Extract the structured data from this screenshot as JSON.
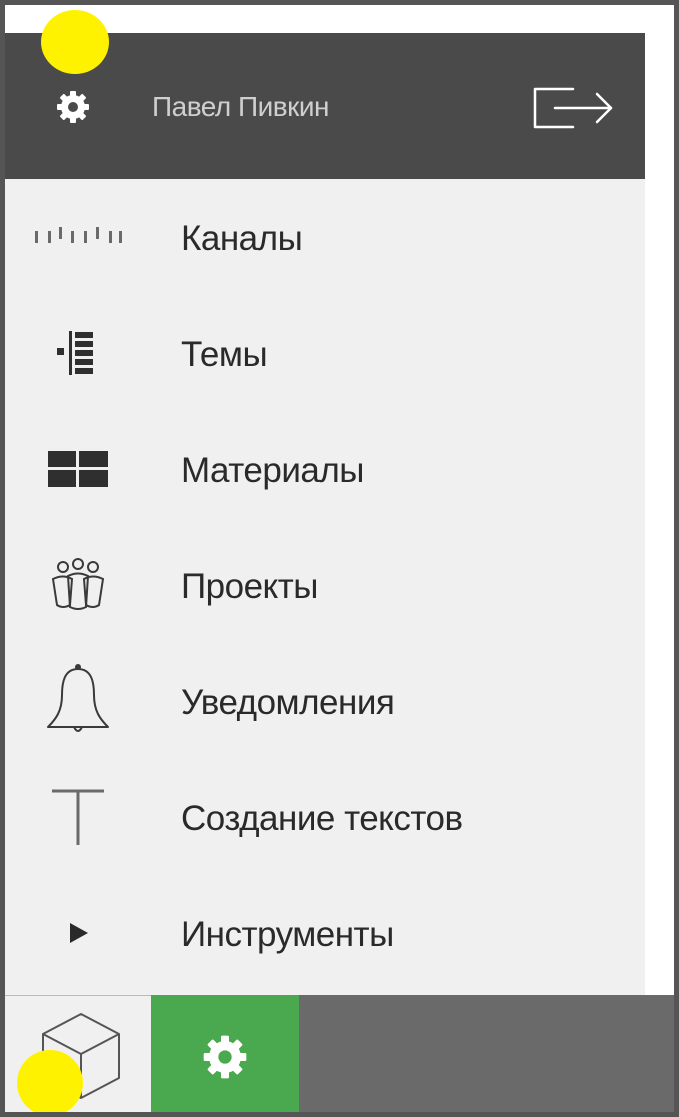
{
  "header": {
    "user_name": "Павел Пивкин",
    "settings_icon": "gear-icon",
    "logout_icon": "logout-arrow-icon"
  },
  "menu": {
    "items": [
      {
        "label": "Каналы",
        "icon": "ruler-ticks-icon"
      },
      {
        "label": "Темы",
        "icon": "list-topics-icon"
      },
      {
        "label": "Материалы",
        "icon": "grid-tiles-icon"
      },
      {
        "label": "Проекты",
        "icon": "team-people-icon"
      },
      {
        "label": "Уведомления",
        "icon": "bell-icon"
      },
      {
        "label": "Создание текстов",
        "icon": "text-t-icon"
      },
      {
        "label": "Инструменты",
        "icon": "play-triangle-icon"
      }
    ]
  },
  "footer": {
    "cube_icon": "cube-icon",
    "settings_icon": "gear-icon"
  },
  "colors": {
    "header_bg": "#4a4a4a",
    "panel_bg": "#f0f0f0",
    "accent_green": "#4aa84e",
    "marker_yellow": "#fff200"
  }
}
